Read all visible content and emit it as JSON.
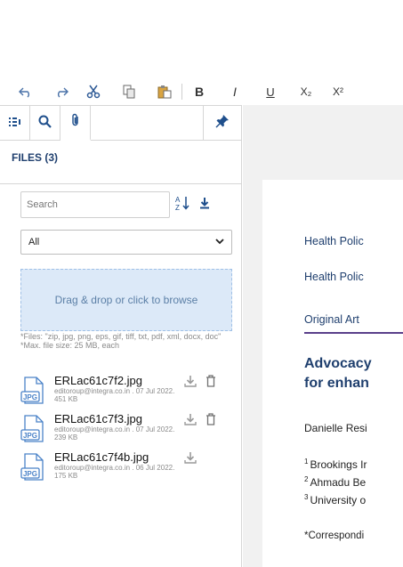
{
  "toolbar": {
    "buttons": [
      {
        "name": "undo-button",
        "icon": "undo-icon",
        "glyph": "↶"
      },
      {
        "name": "redo-button",
        "icon": "redo-icon",
        "glyph": "↷"
      },
      {
        "name": "cut-button",
        "icon": "scissors-icon",
        "glyph": "✂"
      },
      {
        "name": "copy-button",
        "icon": "copy-icon",
        "glyph": "⎘"
      },
      {
        "name": "paste-button",
        "icon": "paste-icon",
        "glyph": "📋"
      },
      {
        "name": "bold-button",
        "label": "B"
      },
      {
        "name": "italic-button",
        "label": "I"
      },
      {
        "name": "underline-button",
        "label": "U"
      },
      {
        "name": "subscript-button",
        "label": "X₂"
      },
      {
        "name": "superscript-button",
        "label": "X²"
      }
    ]
  },
  "panel": {
    "tabs": [
      {
        "name": "tab-outline",
        "icon": "list-icon"
      },
      {
        "name": "tab-search",
        "icon": "search-icon"
      },
      {
        "name": "tab-attachments",
        "icon": "paperclip-icon",
        "active": true
      },
      {
        "name": "tab-pin",
        "icon": "pin-icon"
      }
    ],
    "files_title": "FILES (3)",
    "search": {
      "placeholder": "Search",
      "value": ""
    },
    "filter": {
      "selected": "All"
    },
    "dropzone_label": "Drag & drop or click to browse",
    "hint_line1": "*Files: \"zip, jpg, png, eps, gif, tiff, txt, pdf, xml, docx, doc\"",
    "hint_line2": "*Max. file size: 25 MB, each",
    "files": [
      {
        "name": "ERLac61c7f2.jpg",
        "type": "JPG",
        "meta": "editoroup@integra.co.in . 07 Jul 2022.",
        "size": "451 KB",
        "deletable": true
      },
      {
        "name": "ERLac61c7f3.jpg",
        "type": "JPG",
        "meta": "editoroup@integra.co.in . 07 Jul 2022.",
        "size": "239 KB",
        "deletable": true
      },
      {
        "name": "ERLac61c7f4b.jpg",
        "type": "JPG",
        "meta": "editoroup@integra.co.in . 06 Jul 2022.",
        "size": "175 KB",
        "deletable": false
      }
    ]
  },
  "document": {
    "header1": "Health Polic",
    "header2": "Health Polic",
    "article_type": "Original Art",
    "title_line1": "Advocacy",
    "title_line2": "for enhan",
    "author": "Danielle Resi",
    "affiliations": [
      {
        "num": "1",
        "text": "Brookings Ir"
      },
      {
        "num": "2",
        "text": "Ahmadu Be"
      },
      {
        "num": "3",
        "text": "University o"
      }
    ],
    "corresponding": "*Correspondi"
  },
  "colors": {
    "accent": "#1f4f8c",
    "dropzone": "#dce9f8",
    "rule": "#5a3f8a"
  }
}
